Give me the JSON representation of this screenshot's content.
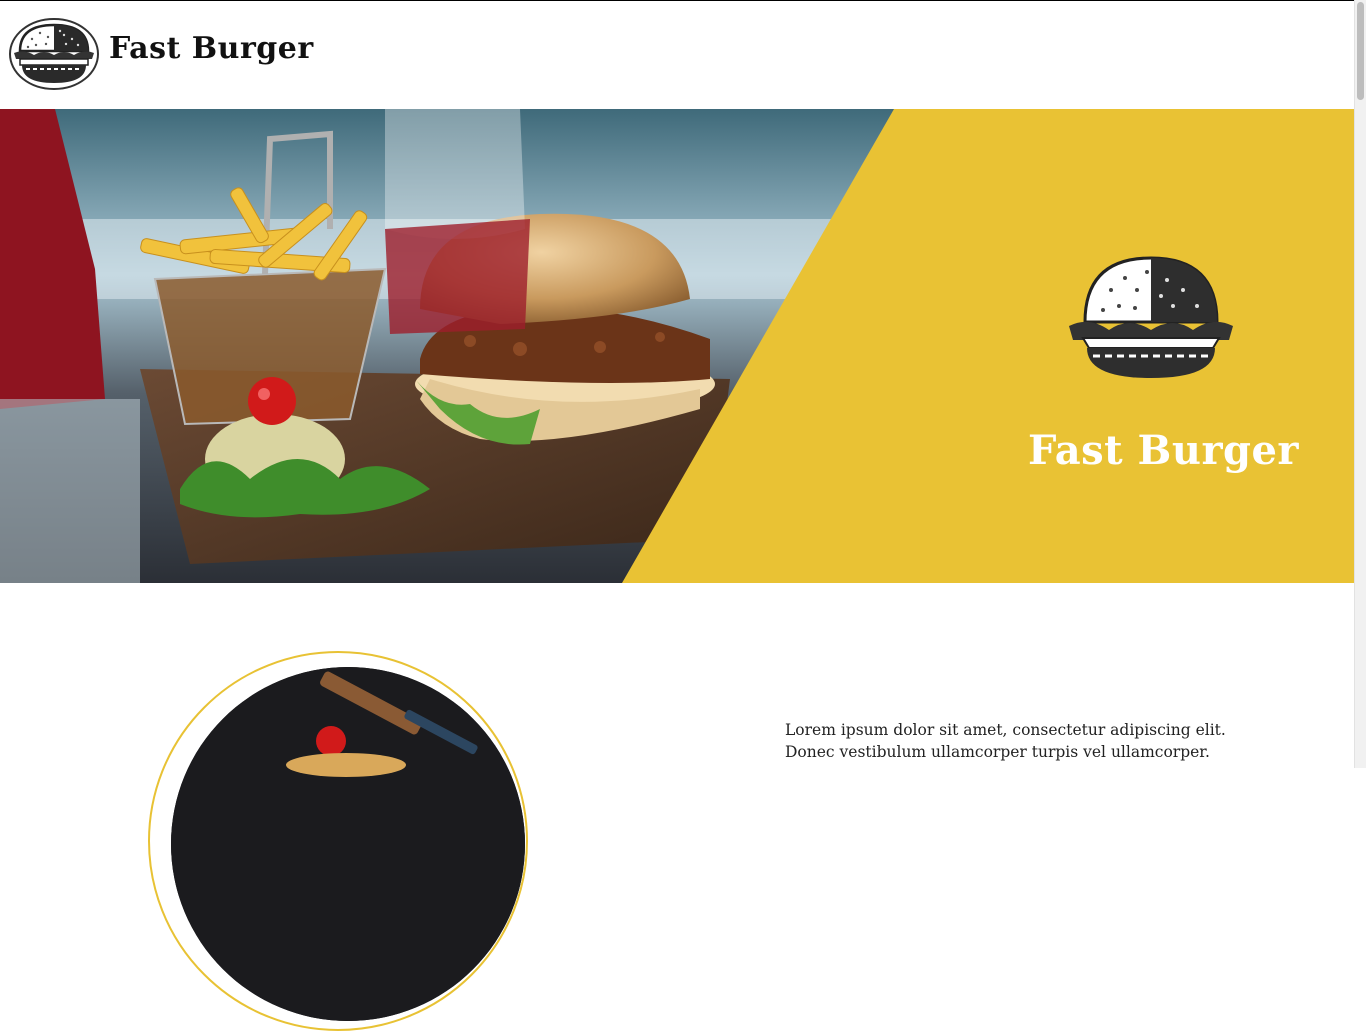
{
  "header": {
    "brand_name": "Fast Burger",
    "logo_icon": "burger-logo-icon"
  },
  "hero": {
    "title": "Fast Burger",
    "logo_icon": "burger-logo-icon",
    "panel_color": "#E9C234",
    "image_subject": "burger-and-fries-photo"
  },
  "about": {
    "text_line_1": "Lorem ipsum dolor sit amet, consectetur adipiscing elit.",
    "text_line_2": "Donec vestibulum ullamcorper turpis vel ullamcorper.",
    "accent_color": "#E9C234"
  }
}
